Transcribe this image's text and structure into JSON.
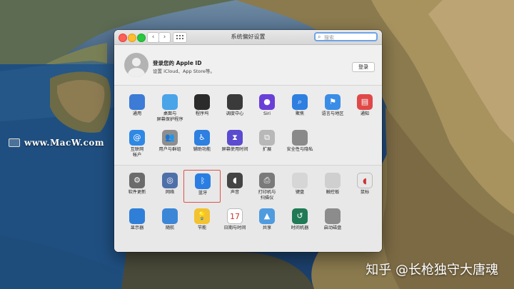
{
  "watermark": "www.MacW.com",
  "credit": "知乎 @长枪独守大唐魂",
  "window": {
    "title": "系统偏好设置",
    "search_placeholder": "搜索",
    "nav_back": "‹",
    "nav_forward": "›"
  },
  "account": {
    "title": "登录您的 Apple ID",
    "subtitle": "设置 iCloud、App Store等。",
    "login_button": "登录"
  },
  "panes_top": [
    {
      "name": "通用",
      "icon": "general-icon",
      "color": "#3c7bd6"
    },
    {
      "name": "桌面与\n屏幕保护程序",
      "icon": "desktop-screensaver-icon",
      "color": "#4aa4e8"
    },
    {
      "name": "程序坞",
      "icon": "dock-icon",
      "color": "#2b2b2b"
    },
    {
      "name": "调度中心",
      "icon": "mission-control-icon",
      "color": "#3a3a3a"
    },
    {
      "name": "Siri",
      "icon": "siri-icon",
      "color": "#6a3fd8"
    },
    {
      "name": "聚焦",
      "icon": "spotlight-icon",
      "color": "#2e7fe0"
    },
    {
      "name": "语言与地区",
      "icon": "language-region-icon",
      "color": "#3a8de6"
    },
    {
      "name": "通知",
      "icon": "notifications-icon",
      "color": "#e04848"
    },
    {
      "name": "互联网\n帐户",
      "icon": "internet-accounts-icon",
      "color": "#2f88e4"
    },
    {
      "name": "用户与群组",
      "icon": "users-groups-icon",
      "color": "#8e8e8e"
    },
    {
      "name": "辅助功能",
      "icon": "accessibility-icon",
      "color": "#2d7fe0"
    },
    {
      "name": "屏幕使用时间",
      "icon": "screen-time-icon",
      "color": "#5a4bd0"
    },
    {
      "name": "扩展",
      "icon": "extensions-icon",
      "color": "#b8b8b8"
    },
    {
      "name": "安全性与隐私",
      "icon": "security-privacy-icon",
      "color": "#8a8a8a"
    }
  ],
  "panes_bottom": [
    {
      "name": "软件更新",
      "icon": "software-update-icon",
      "color": "#6b6b6b"
    },
    {
      "name": "网络",
      "icon": "network-icon",
      "color": "#4f6fa8"
    },
    {
      "name": "蓝牙",
      "icon": "bluetooth-icon",
      "color": "#2a7ee2"
    },
    {
      "name": "声音",
      "icon": "sound-icon",
      "color": "#444444"
    },
    {
      "name": "打印机与\n扫描仪",
      "icon": "printers-scanners-icon",
      "color": "#7a7a7a"
    },
    {
      "name": "键盘",
      "icon": "keyboard-icon",
      "color": "#d6d6d6"
    },
    {
      "name": "触控板",
      "icon": "trackpad-icon",
      "color": "#cfcfcf"
    },
    {
      "name": "鼠标",
      "icon": "mouse-icon",
      "color": "#e8e8e8"
    },
    {
      "name": "显示器",
      "icon": "displays-icon",
      "color": "#2f7fd8"
    },
    {
      "name": "随航",
      "icon": "sidecar-icon",
      "color": "#3c86d8"
    },
    {
      "name": "节能",
      "icon": "energy-saver-icon",
      "color": "#f2c230"
    },
    {
      "name": "日期与时间",
      "icon": "date-time-icon",
      "color": "#ffffff"
    },
    {
      "name": "共享",
      "icon": "sharing-icon",
      "color": "#4f9be0"
    },
    {
      "name": "时间机器",
      "icon": "time-machine-icon",
      "color": "#1f7a55"
    },
    {
      "name": "启动磁盘",
      "icon": "startup-disk-icon",
      "color": "#8c8c8c"
    }
  ],
  "selected_pane": "蓝牙"
}
